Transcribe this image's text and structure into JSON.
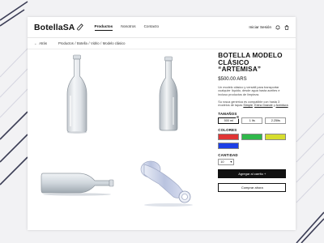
{
  "brand": {
    "name": "BotellaSA"
  },
  "nav": {
    "items": [
      {
        "label": "Productos",
        "active": true
      },
      {
        "label": "Nosotros",
        "active": false
      },
      {
        "label": "Contacto",
        "active": false
      }
    ],
    "login_label": "Iniciar Sesión",
    "icons": [
      "bell-icon",
      "cart-icon"
    ]
  },
  "breadcrumb": {
    "back_label": "Atrás",
    "items": [
      "Productos",
      "Botella",
      "Vidrio"
    ],
    "current": "Modelo clásico"
  },
  "product": {
    "title_line1": "BOTELLA MODELO",
    "title_line2": "CLÁSICO",
    "title_line3": "“ARTEMISA”",
    "price": "$500.00 ARS",
    "description": "Un modelo clásico y versátil para transportar cualquier líquido, desde agua hasta aceites e incluso productos de limpieza.",
    "compat_text": "Su rosca genérica es compatible con hasta 3 modelos de tapas",
    "compat_links": [
      "Simple",
      "Extra Grande",
      "Aventura"
    ],
    "sizes_label": "TAMAÑOS",
    "sizes": [
      "500 ml",
      "1 lts",
      "2.25lts"
    ],
    "selected_size": "500 ml",
    "colors_label": "COLORES",
    "colors": [
      "#e03434",
      "#2fb84a",
      "#d6dd2e",
      "#1c3fe6"
    ],
    "quantity_label": "CANTIDAD",
    "quantity": "10",
    "add_to_cart_label": "Agregar al carrito +",
    "buy_now_label": "Comprar ahora"
  }
}
